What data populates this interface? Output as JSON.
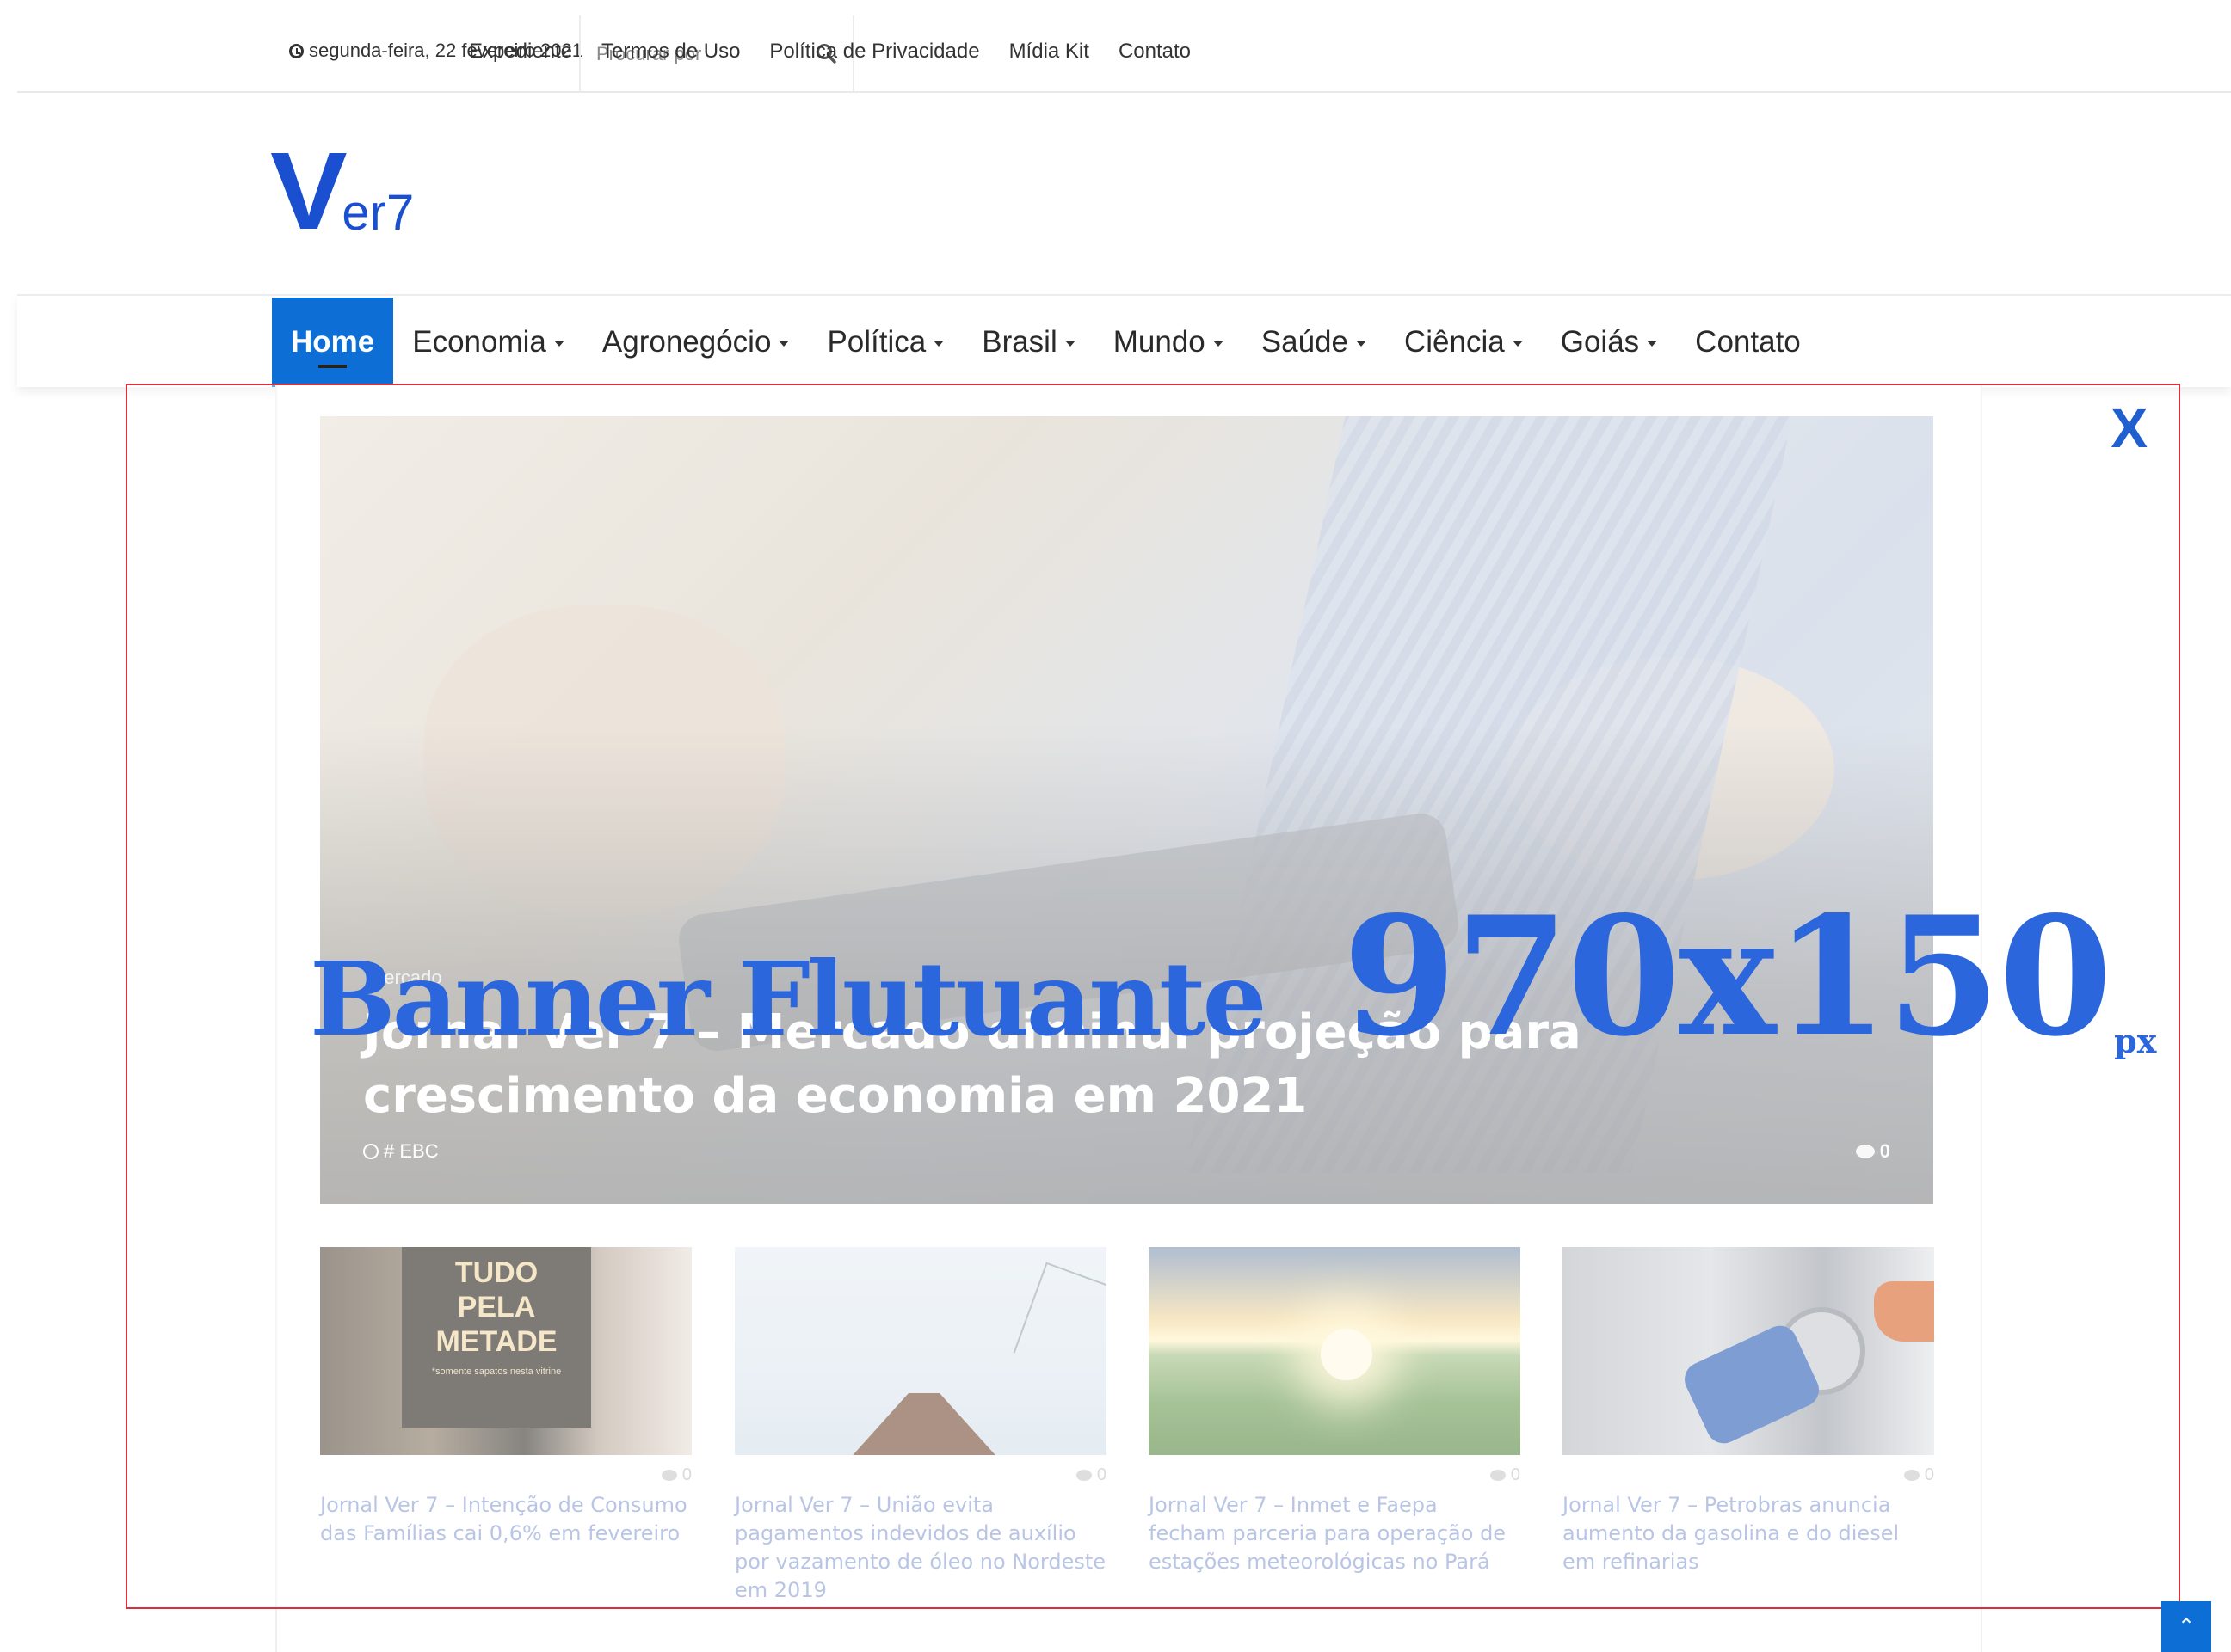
{
  "topbar": {
    "date": "segunda-feira, 22 fevereiro 2021",
    "search_placeholder": "Procurar por",
    "links": [
      "Expediente",
      "Termos de Uso",
      "Política de Privacidade",
      "Mídia Kit",
      "Contato"
    ]
  },
  "logo": {
    "letter": "V",
    "rest": "er7",
    "color": "#1a4fcf"
  },
  "nav": {
    "items": [
      {
        "label": "Home",
        "active": true,
        "dropdown": false
      },
      {
        "label": "Economia",
        "dropdown": true
      },
      {
        "label": "Agronegócio",
        "dropdown": true
      },
      {
        "label": "Política",
        "dropdown": true
      },
      {
        "label": "Brasil",
        "dropdown": true
      },
      {
        "label": "Mundo",
        "dropdown": true
      },
      {
        "label": "Saúde",
        "dropdown": true
      },
      {
        "label": "Ciência",
        "dropdown": true
      },
      {
        "label": "Goiás",
        "dropdown": true
      },
      {
        "label": "Contato",
        "dropdown": false
      }
    ],
    "accent": "#0d6fd6"
  },
  "hero": {
    "category": "Mercado",
    "title": "Jornal Ver 7 – Mercado diminui projeção para crescimento da economia em 2021",
    "author": "# EBC",
    "comments": "0"
  },
  "cards": [
    {
      "title": "Jornal Ver 7 – Intenção de Consumo das Famílias cai 0,6% em fevereiro",
      "comments": "0",
      "sign_lines": [
        "TUDO",
        "PELA",
        "METADE"
      ],
      "sign_small": "*somente sapatos nesta vitrine"
    },
    {
      "title": "Jornal Ver 7 – União evita pagamentos indevidos de auxílio por vazamento de óleo no Nordeste em 2019",
      "comments": "0"
    },
    {
      "title": "Jornal Ver 7 – Inmet e Faepa fecham parceria para operação de estações meteorológicas no Pará",
      "comments": "0"
    },
    {
      "title": "Jornal Ver 7 – Petrobras anuncia aumento da gasolina e do diesel em refinarias",
      "comments": "0"
    }
  ],
  "banner": {
    "label": "Banner Flutuante",
    "size": "970x150",
    "unit": "px",
    "close": "X",
    "border_color": "#d9303b",
    "text_color": "#2b66dc"
  },
  "back_to_top": "⌃"
}
